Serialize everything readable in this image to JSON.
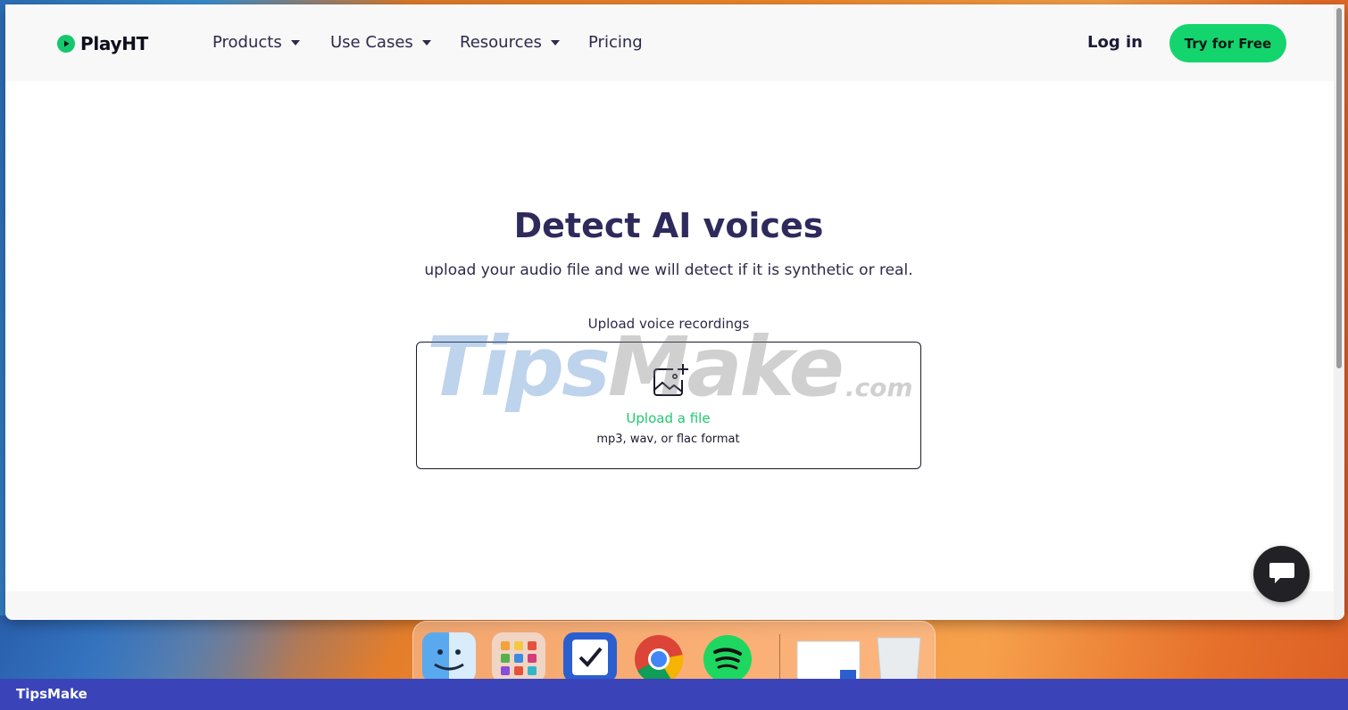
{
  "nav": {
    "brand": "PlayHT",
    "items": [
      {
        "label": "Products"
      },
      {
        "label": "Use Cases"
      },
      {
        "label": "Resources"
      },
      {
        "label": "Pricing"
      }
    ],
    "login": "Log in",
    "cta": "Try for Free"
  },
  "hero": {
    "title": "Detect AI voices",
    "subtitle": "upload your audio file and we will detect if it is synthetic or real."
  },
  "upload": {
    "label": "Upload voice recordings",
    "link": "Upload a file",
    "formats": "mp3, wav, or flac format"
  },
  "watermark": {
    "tips": "Tips",
    "make": "Make",
    "com": ".com"
  },
  "dock": {
    "apps": [
      "finder-icon",
      "launchpad-icon",
      "tasks-icon",
      "chrome-icon",
      "spotify-icon",
      "preview-window-icon",
      "trash-icon"
    ]
  },
  "footer_brand": "TipsMake",
  "colors": {
    "accent": "#14d46e",
    "title": "#2e2a5c",
    "frame": "#3a44b8"
  }
}
